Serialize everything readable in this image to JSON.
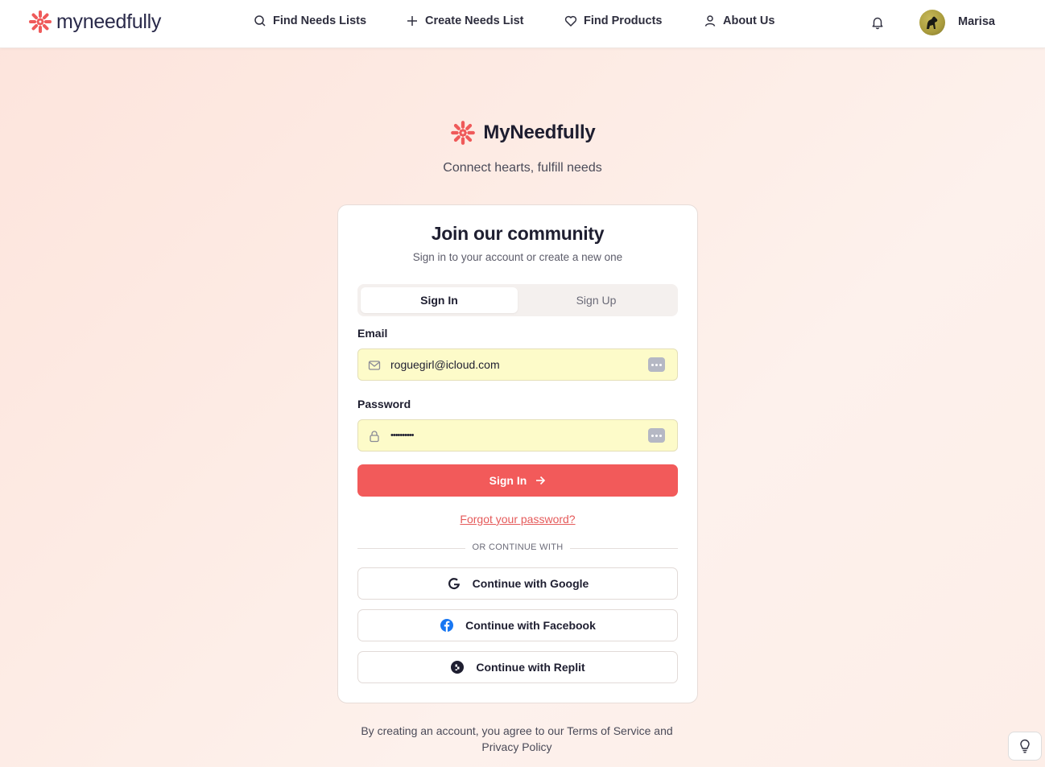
{
  "header": {
    "logo_text": "myneedfully",
    "nav": [
      {
        "label": "Find Needs Lists",
        "icon": "search-icon"
      },
      {
        "label": "Create Needs List",
        "icon": "plus-icon"
      },
      {
        "label": "Find Products",
        "icon": "heart-icon"
      },
      {
        "label": "About Us",
        "icon": "user-icon"
      }
    ],
    "notifications_icon": "bell-icon",
    "user_name": "Marisa"
  },
  "brand": {
    "title": "MyNeedfully",
    "tagline": "Connect hearts, fulfill needs"
  },
  "auth_card": {
    "title": "Join our community",
    "subtitle": "Sign in to your account or create a new one",
    "tabs": [
      {
        "label": "Sign In",
        "active": true
      },
      {
        "label": "Sign Up",
        "active": false
      }
    ],
    "email": {
      "label": "Email",
      "value": "roguegirl@icloud.com"
    },
    "password": {
      "label": "Password",
      "value": "••••••••••"
    },
    "submit_label": "Sign In",
    "forgot_label": "Forgot your password?",
    "divider_label": "OR CONTINUE WITH",
    "social": [
      {
        "label": "Continue with Google",
        "icon": "google-icon"
      },
      {
        "label": "Continue with Facebook",
        "icon": "facebook-icon"
      },
      {
        "label": "Continue with Replit",
        "icon": "replit-icon"
      }
    ]
  },
  "footer": {
    "terms_prefix": "By creating an account, you agree to our ",
    "terms_link": "Terms of Service",
    "terms_and": " and",
    "privacy_link": "Privacy Policy"
  },
  "colors": {
    "accent": "#f25a5a",
    "autofill_bg": "#fdfbc9",
    "facebook": "#1877f2"
  }
}
